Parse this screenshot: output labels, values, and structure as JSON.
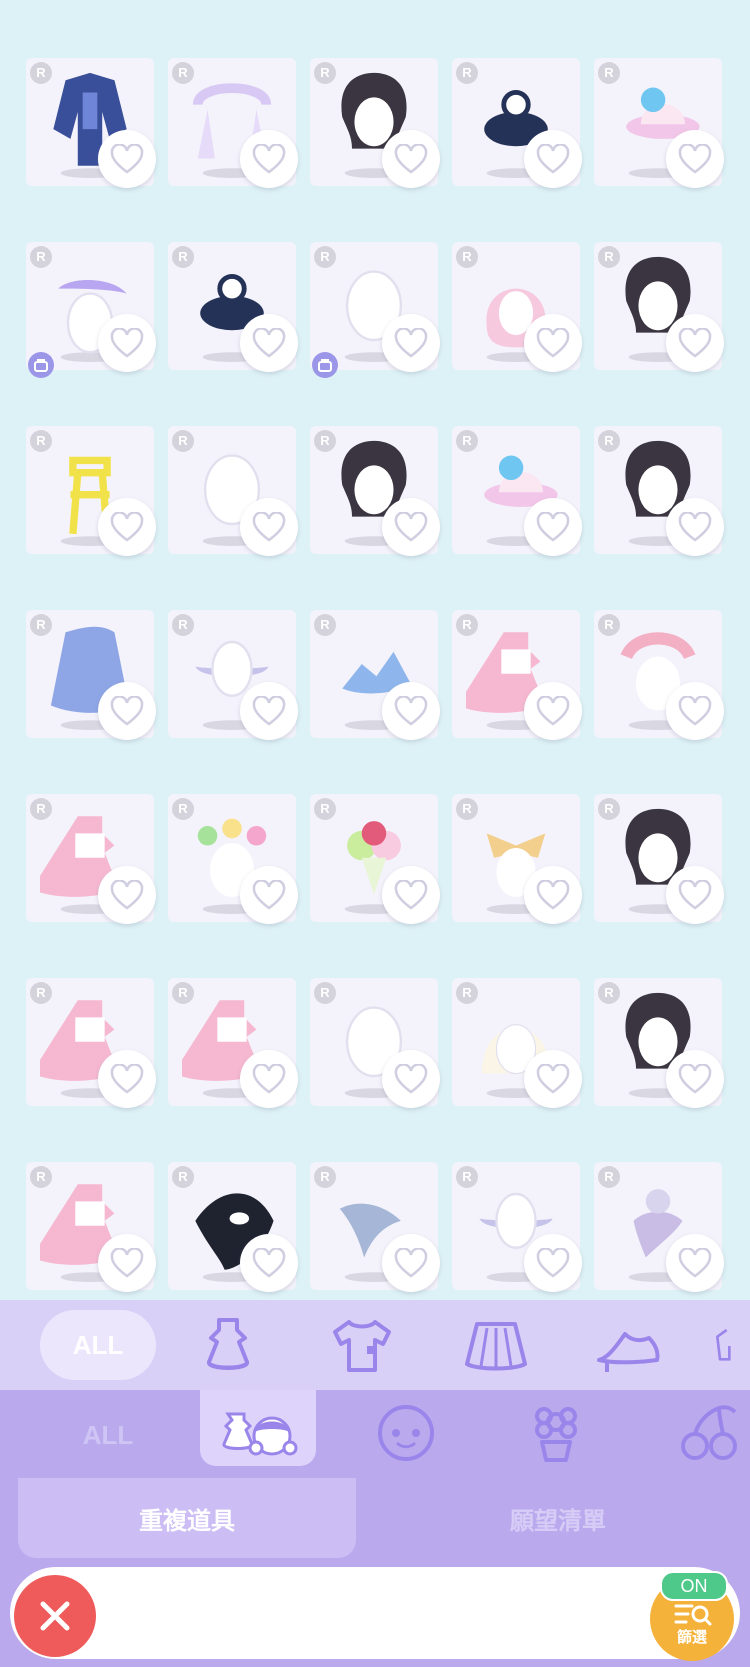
{
  "items": [
    {
      "row": 0,
      "col": 0,
      "badge": "R",
      "icon": "jacket-icon",
      "bag": false
    },
    {
      "row": 0,
      "col": 1,
      "badge": "R",
      "icon": "ribbon-hairpiece-icon",
      "bag": false
    },
    {
      "row": 0,
      "col": 2,
      "badge": "R",
      "icon": "hair-icon",
      "bag": false
    },
    {
      "row": 0,
      "col": 3,
      "badge": "R",
      "icon": "pet-icon",
      "bag": false
    },
    {
      "row": 0,
      "col": 4,
      "badge": "R",
      "icon": "hat-icon",
      "bag": false
    },
    {
      "row": 1,
      "col": 0,
      "badge": "R",
      "icon": "visor-icon",
      "bag": true
    },
    {
      "row": 1,
      "col": 1,
      "badge": "R",
      "icon": "pet-icon",
      "bag": false
    },
    {
      "row": 1,
      "col": 2,
      "badge": "R",
      "icon": "face-icon",
      "bag": true
    },
    {
      "row": 1,
      "col": 3,
      "badge": "R",
      "icon": "hood-icon",
      "bag": false
    },
    {
      "row": 1,
      "col": 4,
      "badge": "R",
      "icon": "hair-icon",
      "bag": false
    },
    {
      "row": 2,
      "col": 0,
      "badge": "R",
      "icon": "harness-icon",
      "bag": false
    },
    {
      "row": 2,
      "col": 1,
      "badge": "R",
      "icon": "face-icon",
      "bag": false
    },
    {
      "row": 2,
      "col": 2,
      "badge": "R",
      "icon": "hair-icon",
      "bag": false
    },
    {
      "row": 2,
      "col": 3,
      "badge": "R",
      "icon": "hat-icon",
      "bag": false
    },
    {
      "row": 2,
      "col": 4,
      "badge": "R",
      "icon": "hair-icon",
      "bag": false
    },
    {
      "row": 3,
      "col": 0,
      "badge": "R",
      "icon": "cape-icon",
      "bag": false
    },
    {
      "row": 3,
      "col": 1,
      "badge": "R",
      "icon": "wings-icon",
      "bag": false
    },
    {
      "row": 3,
      "col": 2,
      "badge": "R",
      "icon": "crystal-icon",
      "bag": false
    },
    {
      "row": 3,
      "col": 3,
      "badge": "R",
      "icon": "dress-icon",
      "bag": false
    },
    {
      "row": 3,
      "col": 4,
      "badge": "R",
      "icon": "headband-icon",
      "bag": false
    },
    {
      "row": 4,
      "col": 0,
      "badge": "R",
      "icon": "dress-icon",
      "bag": false
    },
    {
      "row": 4,
      "col": 1,
      "badge": "R",
      "icon": "flower-crown-icon",
      "bag": false
    },
    {
      "row": 4,
      "col": 2,
      "badge": "R",
      "icon": "bouquet-icon",
      "bag": false
    },
    {
      "row": 4,
      "col": 3,
      "badge": "R",
      "icon": "bow-icon",
      "bag": false
    },
    {
      "row": 4,
      "col": 4,
      "badge": "R",
      "icon": "hair-icon",
      "bag": false
    },
    {
      "row": 5,
      "col": 0,
      "badge": "R",
      "icon": "dress-icon",
      "bag": false
    },
    {
      "row": 5,
      "col": 1,
      "badge": "R",
      "icon": "dress-icon",
      "bag": false
    },
    {
      "row": 5,
      "col": 2,
      "badge": "R",
      "icon": "face-icon",
      "bag": false
    },
    {
      "row": 5,
      "col": 3,
      "badge": "R",
      "icon": "veil-icon",
      "bag": false
    },
    {
      "row": 5,
      "col": 4,
      "badge": "R",
      "icon": "hair-icon",
      "bag": false
    },
    {
      "row": 6,
      "col": 0,
      "badge": "R",
      "icon": "dress-icon",
      "bag": false
    },
    {
      "row": 6,
      "col": 1,
      "badge": "R",
      "icon": "orca-icon",
      "bag": false
    },
    {
      "row": 6,
      "col": 2,
      "badge": "R",
      "icon": "dolphin-icon",
      "bag": false
    },
    {
      "row": 6,
      "col": 3,
      "badge": "R",
      "icon": "wings-icon",
      "bag": false
    },
    {
      "row": 6,
      "col": 4,
      "badge": "R",
      "icon": "mermaid-icon",
      "bag": false
    }
  ],
  "top_tabs": {
    "all_label": "ALL",
    "icons": [
      "dress-icon",
      "shirt-icon",
      "skirt-icon",
      "shoe-icon",
      "coat-icon"
    ]
  },
  "sub_tabs": {
    "all_label": "ALL",
    "icons": [
      "outfit-girl-icon",
      "face-icon",
      "potted-flower-icon",
      "cherry-icon"
    ]
  },
  "bottom_tabs": {
    "duplicate_items": "重複道具",
    "wishlist": "願望清單"
  },
  "footer": {
    "filter_toggle": "ON",
    "filter_label": "篩選"
  },
  "colors": {
    "bg": "#ddf2f6",
    "tray_light": "#d8d0f7",
    "tray": "#bba9ee",
    "accent": "#a08cf0",
    "close": "#ef5b5b",
    "filter": "#f5b23a",
    "on_badge": "#4fc98a"
  }
}
